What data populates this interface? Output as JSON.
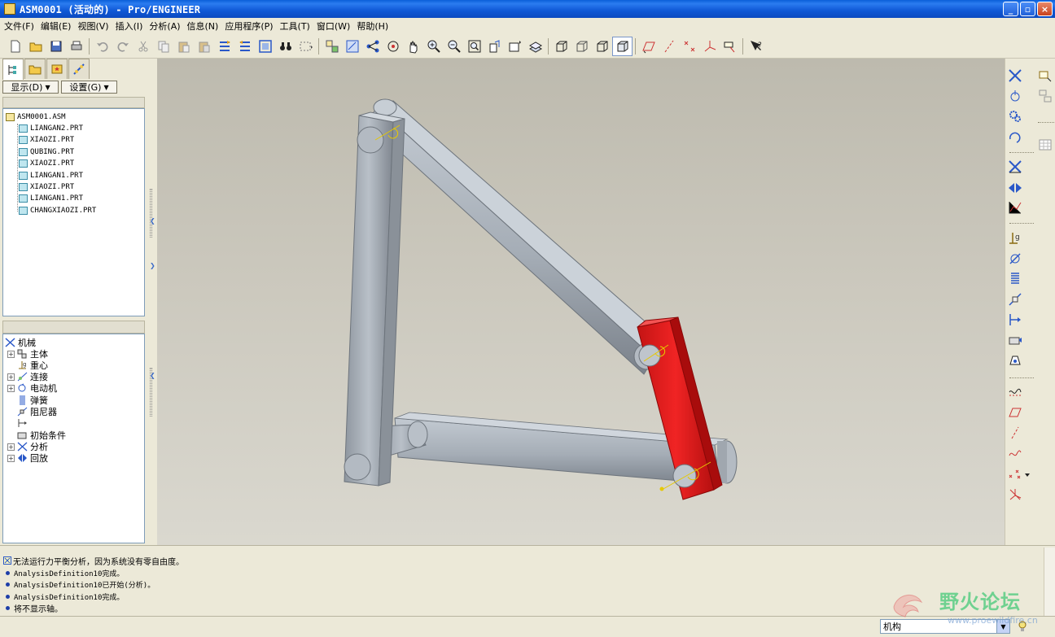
{
  "window": {
    "title": "ASM0001 (活动的) - Pro/ENGINEER",
    "minimize": "_",
    "maximize": "▫",
    "close": "×"
  },
  "menu": [
    "文件(F)",
    "编辑(E)",
    "视图(V)",
    "插入(I)",
    "分析(A)",
    "信息(N)",
    "应用程序(P)",
    "工具(T)",
    "窗口(W)",
    "帮助(H)"
  ],
  "navigator": {
    "display_button": "显示(D)",
    "settings_button": "设置(G)"
  },
  "model_tree": {
    "root": "ASM0001.ASM",
    "items": [
      "LIANGAN2.PRT",
      "XIAOZI.PRT",
      "QUBING.PRT",
      "XIAOZI.PRT",
      "LIANGAN1.PRT",
      "XIAOZI.PRT",
      "LIANGAN1.PRT",
      "CHANGXIAOZI.PRT"
    ]
  },
  "mechanism_tree": {
    "root": "机械",
    "items": [
      "主体",
      "重心",
      "连接",
      "电动机",
      "弹簧",
      "阻尼器",
      "初始条件",
      "分析",
      "回放"
    ]
  },
  "messages": {
    "warning": "无法运行力平衡分析，因为系统没有零自由度。",
    "lines": [
      "AnalysisDefinition10完成。",
      "AnalysisDefinition10已开始(分析)。",
      "AnalysisDefinition10完成。",
      "将不显示轴。"
    ]
  },
  "status": {
    "filter_value": "机构"
  },
  "watermark": {
    "text": "野火论坛",
    "url": "www.proewildfire.cn"
  },
  "colors": {
    "link_gray": "#a7aeb6",
    "crank_red": "#e82020",
    "viewport_top": "#bdbaae",
    "viewport_bottom": "#dad8cf"
  }
}
